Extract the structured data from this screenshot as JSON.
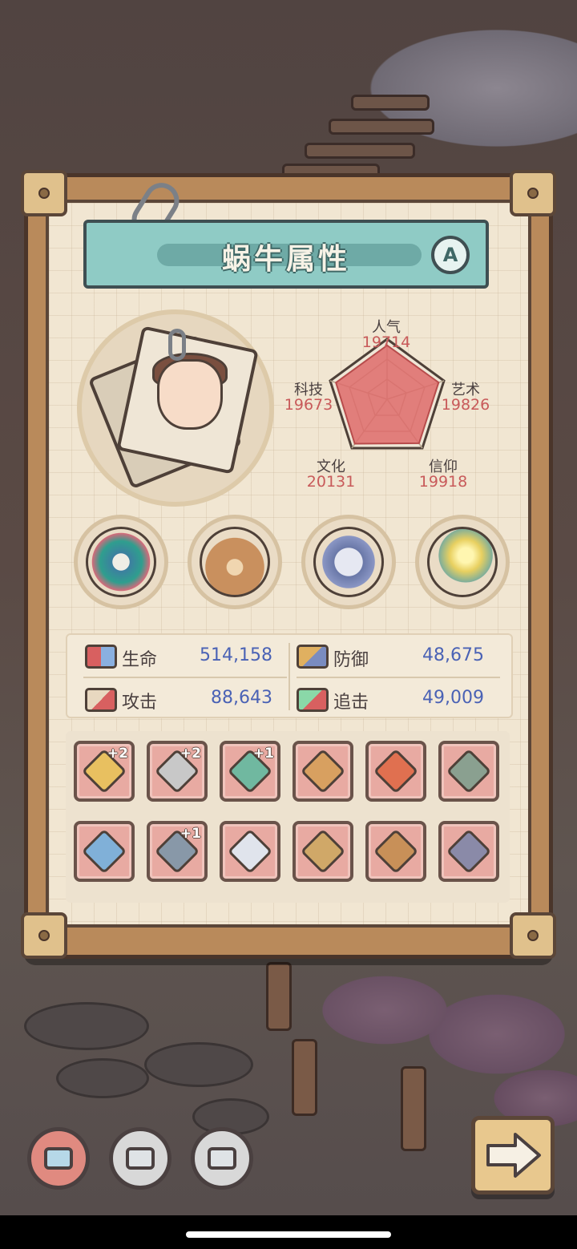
{
  "panel": {
    "title": "蜗牛属性",
    "grade": "A"
  },
  "attributes": [
    {
      "label": "人气",
      "value": "19714"
    },
    {
      "label": "艺术",
      "value": "19826"
    },
    {
      "label": "信仰",
      "value": "19918"
    },
    {
      "label": "文化",
      "value": "20131"
    },
    {
      "label": "科技",
      "value": "19673"
    }
  ],
  "relics": [
    {
      "icon": "dragon-relic-icon"
    },
    {
      "icon": "teddy-bear-relic-icon"
    },
    {
      "icon": "compass-relic-icon"
    },
    {
      "icon": "golden-fire-relic-icon"
    }
  ],
  "stats": {
    "hp": {
      "label": "生命",
      "value": "514,158"
    },
    "defense": {
      "label": "防御",
      "value": "48,675"
    },
    "attack": {
      "label": "攻击",
      "value": "88,643"
    },
    "chase": {
      "label": "追击",
      "value": "49,009"
    }
  },
  "equipment": [
    {
      "icon": "golden-scepter-icon",
      "plus": "+2"
    },
    {
      "icon": "dagger-icon",
      "plus": "+2"
    },
    {
      "icon": "serpent-staff-icon",
      "plus": "+1"
    },
    {
      "icon": "nunchaku-icon",
      "plus": ""
    },
    {
      "icon": "rocket-blade-icon",
      "plus": ""
    },
    {
      "icon": "war-hammer-icon",
      "plus": ""
    },
    {
      "icon": "longsword-icon",
      "plus": ""
    },
    {
      "icon": "curved-knife-icon",
      "plus": "+1"
    },
    {
      "icon": "spear-tip-icon",
      "plus": ""
    },
    {
      "icon": "orb-device-icon",
      "plus": ""
    },
    {
      "icon": "hook-icon",
      "plus": ""
    },
    {
      "icon": "gauntlet-icon",
      "plus": ""
    }
  ],
  "bottom_tabs": [
    {
      "icon": "monitor-tab-icon",
      "active": true
    },
    {
      "icon": "chip-tab-icon",
      "active": false
    },
    {
      "icon": "circuit-tab-icon",
      "active": false
    }
  ],
  "next_button": {
    "icon": "arrow-right-icon"
  },
  "colors": {
    "title_bar": "#8fcbc5",
    "attr_value": "#c85a5a",
    "stat_value": "#4a62b5",
    "slot_bg": "#e8aaa2",
    "active_tab": "#e08a80"
  }
}
